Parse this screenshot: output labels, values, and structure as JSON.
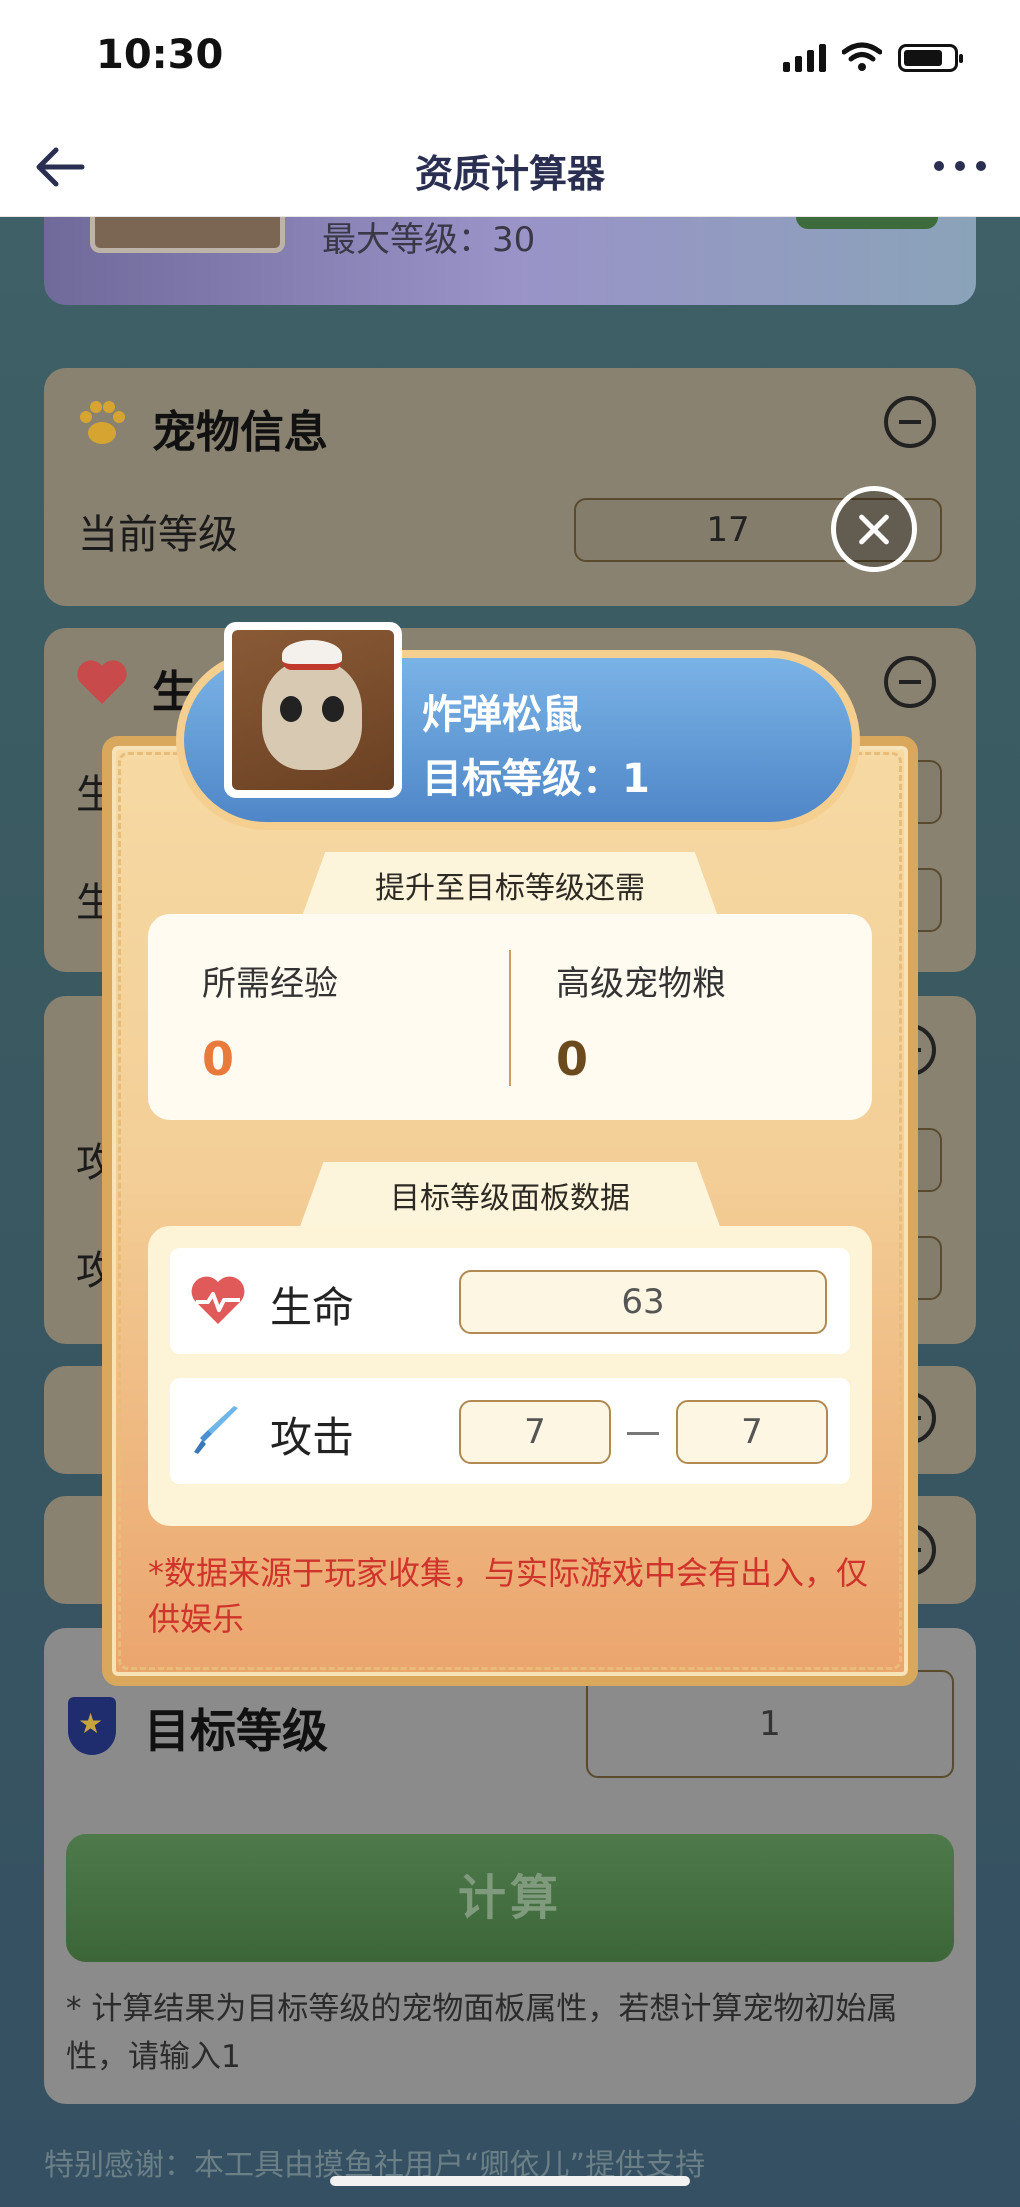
{
  "status_bar": {
    "time": "10:30"
  },
  "navbar": {
    "title": "资质计算器",
    "back_icon": "arrow-left-icon",
    "more_icon": "more-icon"
  },
  "hero": {
    "max_level_text": "最大等级：30"
  },
  "cards": {
    "pet_info": {
      "title": "宠物信息",
      "current_level_label": "当前等级",
      "current_level_value": "17"
    },
    "hp": {
      "title_fragment": "生",
      "row1_label_fragment": "生",
      "row2_label_fragment": "生"
    },
    "attack": {
      "row1_label_fragment": "攻",
      "row2_label_fragment": "攻"
    }
  },
  "target": {
    "label": "目标等级",
    "value": "1",
    "calc_button": "计算",
    "note": "* 计算结果为目标等级的宠物面板属性，若想计算宠物初始属性，请输入1",
    "thanks": "特别感谢：本工具由摸鱼社用户“卿依儿”提供支持"
  },
  "modal": {
    "pet_name": "炸弹松鼠",
    "target_level_text": "目标等级：1",
    "requirements_tab": "提升至目标等级还需",
    "exp_label": "所需经验",
    "exp_value": "0",
    "food_label": "高级宠物粮",
    "food_value": "0",
    "panel_tab": "目标等级面板数据",
    "hp_label": "生命",
    "hp_value": "63",
    "atk_label": "攻击",
    "atk_min": "7",
    "atk_max": "7",
    "disclaimer": "*数据来源于玩家收集，与实际游戏中会有出入，仅供娱乐"
  },
  "colors": {
    "exp_value": "#e87a3c",
    "food_value": "#6b4a1e",
    "disclaimer": "#d0332b"
  }
}
